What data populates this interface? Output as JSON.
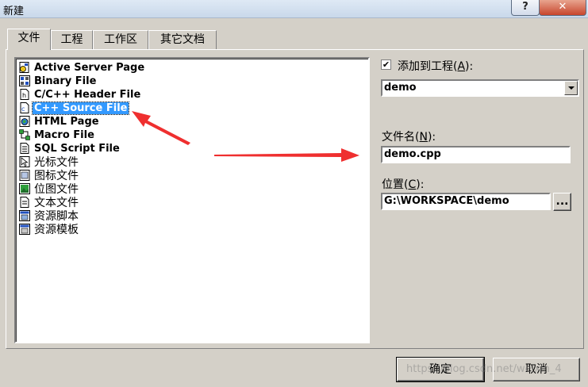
{
  "window": {
    "title": "新建"
  },
  "titlebar_buttons": {
    "help": "?",
    "close": "✕"
  },
  "tabs": [
    {
      "label": "文件",
      "active": true
    },
    {
      "label": "工程",
      "active": false
    },
    {
      "label": "工作区",
      "active": false
    },
    {
      "label": "其它文档",
      "active": false
    }
  ],
  "file_types": [
    {
      "label": "Active Server Page",
      "icon": "asp-file-icon"
    },
    {
      "label": "Binary File",
      "icon": "binary-file-icon"
    },
    {
      "label": "C/C++ Header File",
      "icon": "header-file-icon"
    },
    {
      "label": "C++ Source File",
      "icon": "cpp-file-icon",
      "selected": true
    },
    {
      "label": "HTML Page",
      "icon": "html-file-icon"
    },
    {
      "label": "Macro File",
      "icon": "macro-file-icon"
    },
    {
      "label": "SQL Script File",
      "icon": "sql-file-icon"
    },
    {
      "label": "光标文件",
      "icon": "cursor-file-icon"
    },
    {
      "label": "图标文件",
      "icon": "icon-file-icon"
    },
    {
      "label": "位图文件",
      "icon": "bitmap-file-icon"
    },
    {
      "label": "文本文件",
      "icon": "text-file-icon"
    },
    {
      "label": "资源脚本",
      "icon": "resource-script-icon"
    },
    {
      "label": "资源模板",
      "icon": "resource-template-icon"
    }
  ],
  "add_to_project": {
    "checked": true,
    "label_pre": "添加到工程(",
    "mnemonic": "A",
    "label_post": "):",
    "value": "demo"
  },
  "filename": {
    "label_pre": "文件名(",
    "mnemonic": "N",
    "label_post": "):",
    "value": "demo.cpp"
  },
  "location": {
    "label_pre": "位置(",
    "mnemonic": "C",
    "label_post": "):",
    "value": "G:\\WORKSPACE\\demo",
    "browse_label": "..."
  },
  "buttons": {
    "ok": "确定",
    "cancel": "取消"
  },
  "watermark": "https://blog.csdn.net/weixin_4"
}
